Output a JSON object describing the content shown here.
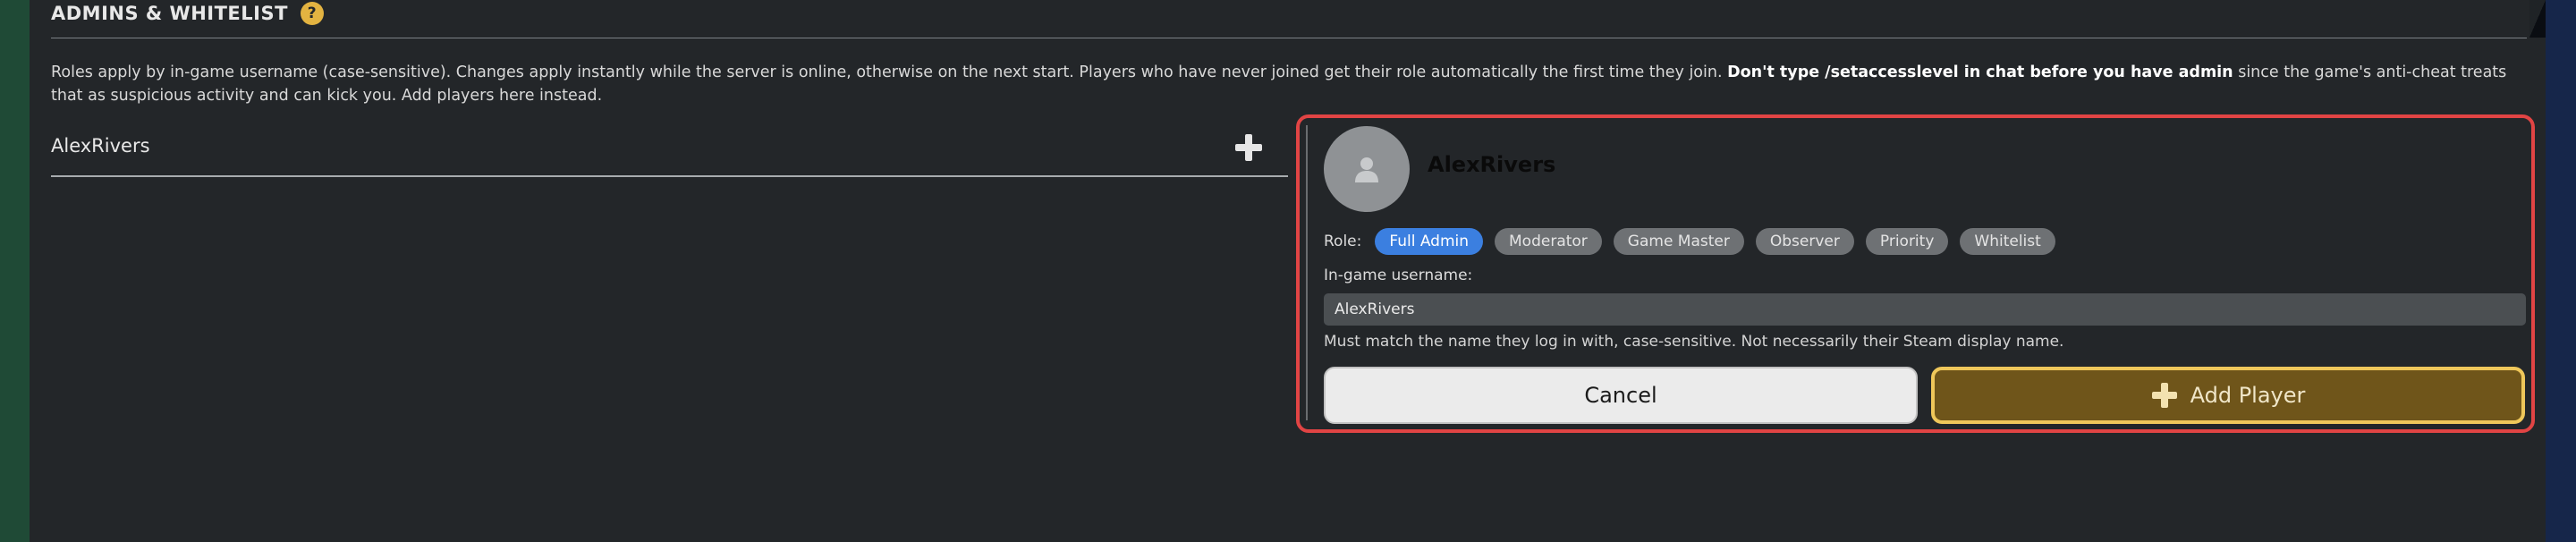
{
  "section": {
    "title": "ADMINS & WHITELIST",
    "help_icon": "question-circle-icon",
    "help_glyph": "?",
    "accent_color": "#e3b341"
  },
  "description": {
    "part1": "Roles apply by in-game username (case-sensitive). Changes apply instantly while the server is online, otherwise on the next start. Players who have never joined get their role automatically the first time they join. ",
    "bold": "Don't type /setaccesslevel in chat before you have admin",
    "part2": " since the game's anti-cheat treats that as suspicious activity and can kick you. Add players here instead."
  },
  "player_list": {
    "items": [
      {
        "name": "AlexRivers",
        "add_icon": "plus-icon"
      }
    ]
  },
  "edit_card": {
    "highlight_color": "#e14444",
    "avatar_icon": "user-silhouette-icon",
    "name": "AlexRivers",
    "role_label": "Role:",
    "roles": [
      {
        "label": "Full Admin",
        "selected": true
      },
      {
        "label": "Moderator",
        "selected": false
      },
      {
        "label": "Game Master",
        "selected": false
      },
      {
        "label": "Observer",
        "selected": false
      },
      {
        "label": "Priority",
        "selected": false
      },
      {
        "label": "Whitelist",
        "selected": false
      }
    ],
    "username_label": "In-game username:",
    "username_value": "AlexRivers",
    "hint": "Must match the name they log in with, case-sensitive. Not necessarily their Steam display name.",
    "cancel_label": "Cancel",
    "add_label": "Add Player",
    "add_icon": "plus-icon",
    "add_color": "#6f551a",
    "add_border_color": "#efc75a",
    "selected_role_color": "#3b7fe0"
  }
}
